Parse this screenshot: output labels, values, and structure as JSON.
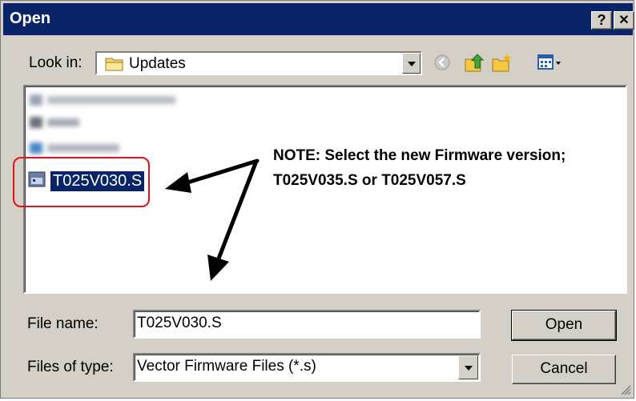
{
  "window": {
    "title": "Open",
    "help_glyph": "?",
    "close_glyph": "✕"
  },
  "lookin": {
    "label": "Look in:",
    "value": "Updates",
    "icon": "folder-icon"
  },
  "toolbar": {
    "icons": [
      "back-icon",
      "up-folder-icon",
      "new-folder-icon",
      "views-menu-icon"
    ]
  },
  "file_list": {
    "selected_file": "T025V030.S"
  },
  "annotation": {
    "note": "NOTE: Select the new Firmware version; T025V035.S or T025V057.S",
    "highlight_color": "#e4111c"
  },
  "filename": {
    "label": "File name:",
    "value": "T025V030.S"
  },
  "filetype": {
    "label": "Files of type:",
    "value": "Vector Firmware Files (*.s)"
  },
  "buttons": {
    "open": "Open",
    "cancel": "Cancel"
  },
  "colors": {
    "titlebar": "#0a246a",
    "face": "#d4d0c8",
    "selection": "#0a246a"
  }
}
